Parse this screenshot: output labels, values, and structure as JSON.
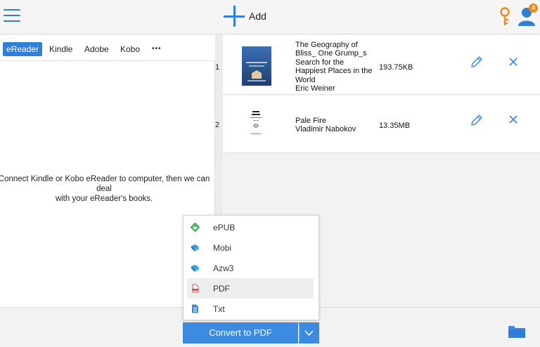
{
  "header": {
    "add_label": "Add",
    "notification_count": "4",
    "accent_color": "#2f7fd9",
    "key_color": "#f28a1d"
  },
  "devices": {
    "tabs": [
      {
        "label": "eReader",
        "active": true
      },
      {
        "label": "Kindle",
        "active": false
      },
      {
        "label": "Adobe",
        "active": false
      },
      {
        "label": "Kobo",
        "active": false
      }
    ],
    "more_label": "•••",
    "empty_message_line1": "Connect Kindle or Kobo eReader to computer, then we can deal",
    "empty_message_line2": "with your eReader's books."
  },
  "books": [
    {
      "index": "1",
      "title_lines": [
        "The Geography of",
        "Bliss_ One Grump_s",
        "Search for the",
        "Happiest Places in the",
        "World"
      ],
      "author": "Eric Weiner",
      "size": "193.75KB",
      "cover_icon": "book-cover-blue"
    },
    {
      "index": "2",
      "title_lines": [
        "Pale Fire"
      ],
      "author": "Vladimir Nabokov",
      "size": "13.35MB",
      "cover_icon": "book-cover-white"
    }
  ],
  "format_menu": {
    "items": [
      {
        "label": "ePUB",
        "icon": "epub-icon",
        "selected": false
      },
      {
        "label": "Mobi",
        "icon": "mobi-icon",
        "selected": false
      },
      {
        "label": "Azw3",
        "icon": "azw3-icon",
        "selected": false
      },
      {
        "label": "PDF",
        "icon": "pdf-icon",
        "selected": true
      },
      {
        "label": "Txt",
        "icon": "txt-icon",
        "selected": false
      }
    ]
  },
  "footer": {
    "convert_label": "Convert to PDF"
  }
}
